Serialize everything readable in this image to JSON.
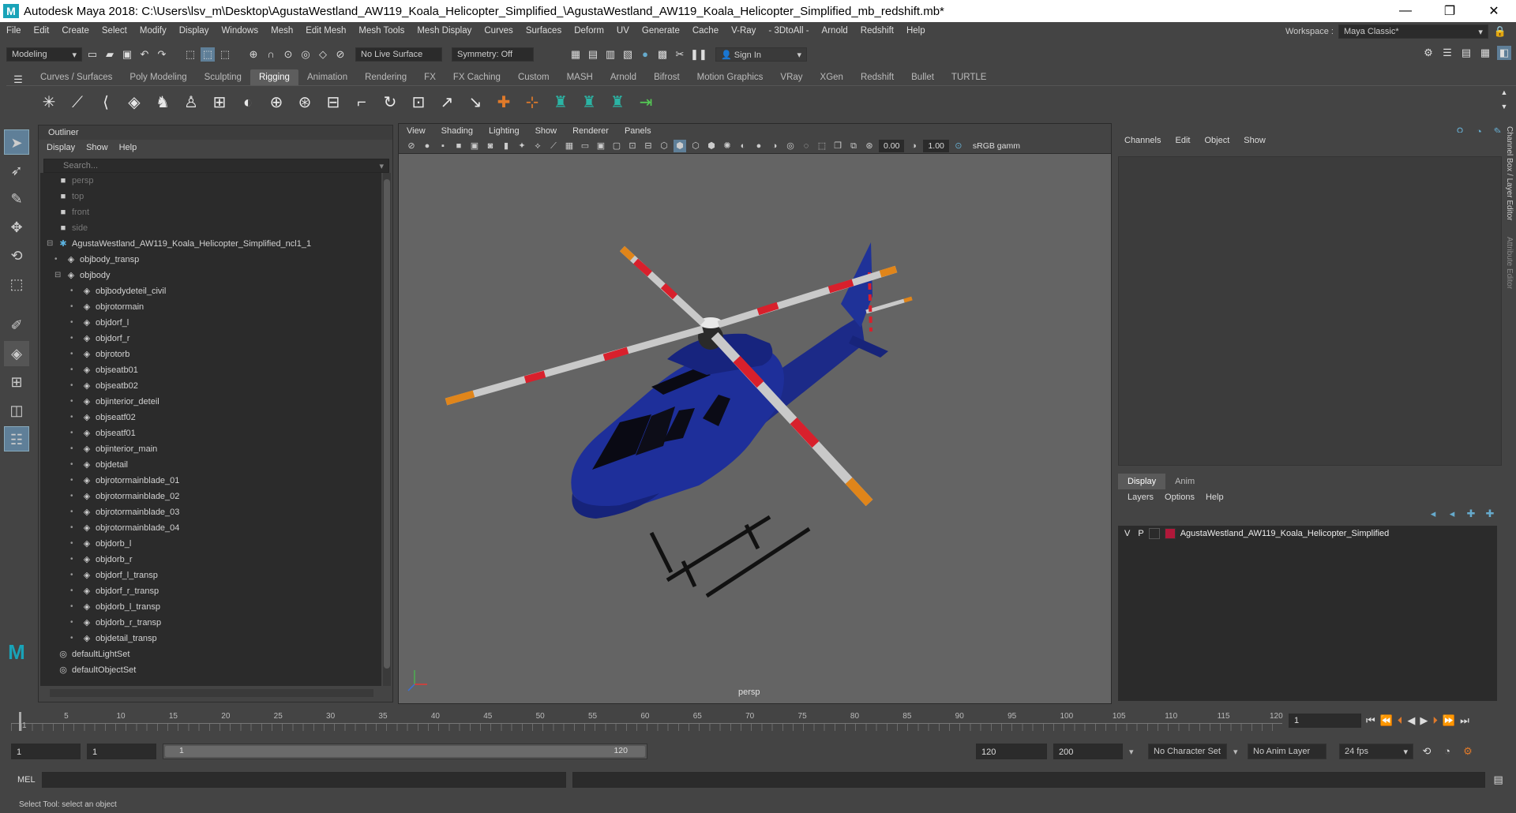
{
  "window": {
    "title": "Autodesk Maya 2018: C:\\Users\\lsv_m\\Desktop\\AgustaWestland_AW119_Koala_Helicopter_Simplified_\\AgustaWestland_AW119_Koala_Helicopter_Simplified_mb_redshift.mb*"
  },
  "menubar": {
    "items": [
      "File",
      "Edit",
      "Create",
      "Select",
      "Modify",
      "Display",
      "Windows",
      "Mesh",
      "Edit Mesh",
      "Mesh Tools",
      "Mesh Display",
      "Curves",
      "Surfaces",
      "Deform",
      "UV",
      "Generate",
      "Cache",
      "V-Ray",
      "- 3DtoAll -",
      "Arnold",
      "Redshift",
      "Help"
    ],
    "workspace_label": "Workspace :",
    "workspace_value": "Maya Classic*"
  },
  "statusline": {
    "mode": "Modeling",
    "live_surface": "No Live Surface",
    "symmetry": "Symmetry: Off",
    "sign_in": "Sign In"
  },
  "shelf": {
    "tabs": [
      "Curves / Surfaces",
      "Poly Modeling",
      "Sculpting",
      "Rigging",
      "Animation",
      "Rendering",
      "FX",
      "FX Caching",
      "Custom",
      "MASH",
      "Arnold",
      "Bifrost",
      "Motion Graphics",
      "VRay",
      "XGen",
      "Redshift",
      "Bullet",
      "TURTLE"
    ],
    "active_tab": "Rigging"
  },
  "outliner": {
    "title": "Outliner",
    "menu": [
      "Display",
      "Show",
      "Help"
    ],
    "search_placeholder": "Search...",
    "items": [
      {
        "label": "persp",
        "dim": true,
        "depth": 0,
        "icon": "camera"
      },
      {
        "label": "top",
        "dim": true,
        "depth": 0,
        "icon": "camera"
      },
      {
        "label": "front",
        "dim": true,
        "depth": 0,
        "icon": "camera"
      },
      {
        "label": "side",
        "dim": true,
        "depth": 0,
        "icon": "camera"
      },
      {
        "label": "AgustaWestland_AW119_Koala_Helicopter_Simplified_ncl1_1",
        "depth": 0,
        "icon": "group",
        "expand": "-"
      },
      {
        "label": "objbody_transp",
        "depth": 1,
        "icon": "mesh",
        "expand": "+"
      },
      {
        "label": "objbody",
        "depth": 1,
        "icon": "mesh",
        "expand": "-"
      },
      {
        "label": "objbodydeteil_civil",
        "depth": 2,
        "icon": "mesh",
        "expand": "+"
      },
      {
        "label": "objrotormain",
        "depth": 2,
        "icon": "mesh",
        "expand": "+"
      },
      {
        "label": "objdorf_l",
        "depth": 2,
        "icon": "mesh",
        "expand": "+"
      },
      {
        "label": "objdorf_r",
        "depth": 2,
        "icon": "mesh",
        "expand": "+"
      },
      {
        "label": "objrotorb",
        "depth": 2,
        "icon": "mesh",
        "expand": "+"
      },
      {
        "label": "objseatb01",
        "depth": 2,
        "icon": "mesh",
        "expand": "+"
      },
      {
        "label": "objseatb02",
        "depth": 2,
        "icon": "mesh",
        "expand": "+"
      },
      {
        "label": "objinterior_deteil",
        "depth": 2,
        "icon": "mesh",
        "expand": "+"
      },
      {
        "label": "objseatf02",
        "depth": 2,
        "icon": "mesh",
        "expand": "+"
      },
      {
        "label": "objseatf01",
        "depth": 2,
        "icon": "mesh",
        "expand": "+"
      },
      {
        "label": "objinterior_main",
        "depth": 2,
        "icon": "mesh",
        "expand": "+"
      },
      {
        "label": "objdetail",
        "depth": 2,
        "icon": "mesh",
        "expand": "+"
      },
      {
        "label": "objrotormainblade_01",
        "depth": 2,
        "icon": "mesh",
        "expand": "+"
      },
      {
        "label": "objrotormainblade_02",
        "depth": 2,
        "icon": "mesh",
        "expand": "+"
      },
      {
        "label": "objrotormainblade_03",
        "depth": 2,
        "icon": "mesh",
        "expand": "+"
      },
      {
        "label": "objrotormainblade_04",
        "depth": 2,
        "icon": "mesh",
        "expand": "+"
      },
      {
        "label": "objdorb_l",
        "depth": 2,
        "icon": "mesh",
        "expand": "+"
      },
      {
        "label": "objdorb_r",
        "depth": 2,
        "icon": "mesh",
        "expand": "+"
      },
      {
        "label": "objdorf_l_transp",
        "depth": 2,
        "icon": "mesh",
        "expand": "+"
      },
      {
        "label": "objdorf_r_transp",
        "depth": 2,
        "icon": "mesh",
        "expand": "+"
      },
      {
        "label": "objdorb_l_transp",
        "depth": 2,
        "icon": "mesh",
        "expand": "+"
      },
      {
        "label": "objdorb_r_transp",
        "depth": 2,
        "icon": "mesh",
        "expand": "+"
      },
      {
        "label": "objdetail_transp",
        "depth": 2,
        "icon": "mesh",
        "expand": "+"
      },
      {
        "label": "defaultLightSet",
        "depth": 0,
        "icon": "set"
      },
      {
        "label": "defaultObjectSet",
        "depth": 0,
        "icon": "set"
      }
    ]
  },
  "viewport": {
    "menu": [
      "View",
      "Shading",
      "Lighting",
      "Show",
      "Renderer",
      "Panels"
    ],
    "exposure": "0.00",
    "gamma": "1.00",
    "color_space": "sRGB gamm",
    "camera_label": "persp",
    "colors": {
      "body": "#1e2f9a",
      "stripe": "#d8202c",
      "blade": "#c9c9c9",
      "tip": "#e0851a"
    }
  },
  "channelbox": {
    "menu": [
      "Channels",
      "Edit",
      "Object",
      "Show"
    ]
  },
  "layer_editor": {
    "tabs": [
      "Display",
      "Anim"
    ],
    "active_tab": "Display",
    "menu": [
      "Layers",
      "Options",
      "Help"
    ],
    "layer": {
      "v": "V",
      "p": "P",
      "name": "AgustaWestland_AW119_Koala_Helicopter_Simplified"
    }
  },
  "side_tabs": [
    "Channel Box / Layer Editor",
    "Attribute Editor"
  ],
  "timeline": {
    "ticks": [
      "1",
      "5",
      "10",
      "15",
      "20",
      "25",
      "30",
      "35",
      "40",
      "45",
      "50",
      "55",
      "60",
      "65",
      "70",
      "75",
      "80",
      "85",
      "90",
      "95",
      "100",
      "105",
      "110",
      "115",
      "120"
    ],
    "current_frame": "1"
  },
  "range": {
    "start": "1",
    "playback_start": "1",
    "slider_start": "1",
    "slider_end": "120",
    "playback_end": "120",
    "end": "200",
    "character_set": "No Character Set",
    "anim_layer": "No Anim Layer",
    "fps": "24 fps"
  },
  "cmdline": {
    "label": "MEL"
  },
  "helpline": {
    "text": "Select Tool: select an object"
  }
}
